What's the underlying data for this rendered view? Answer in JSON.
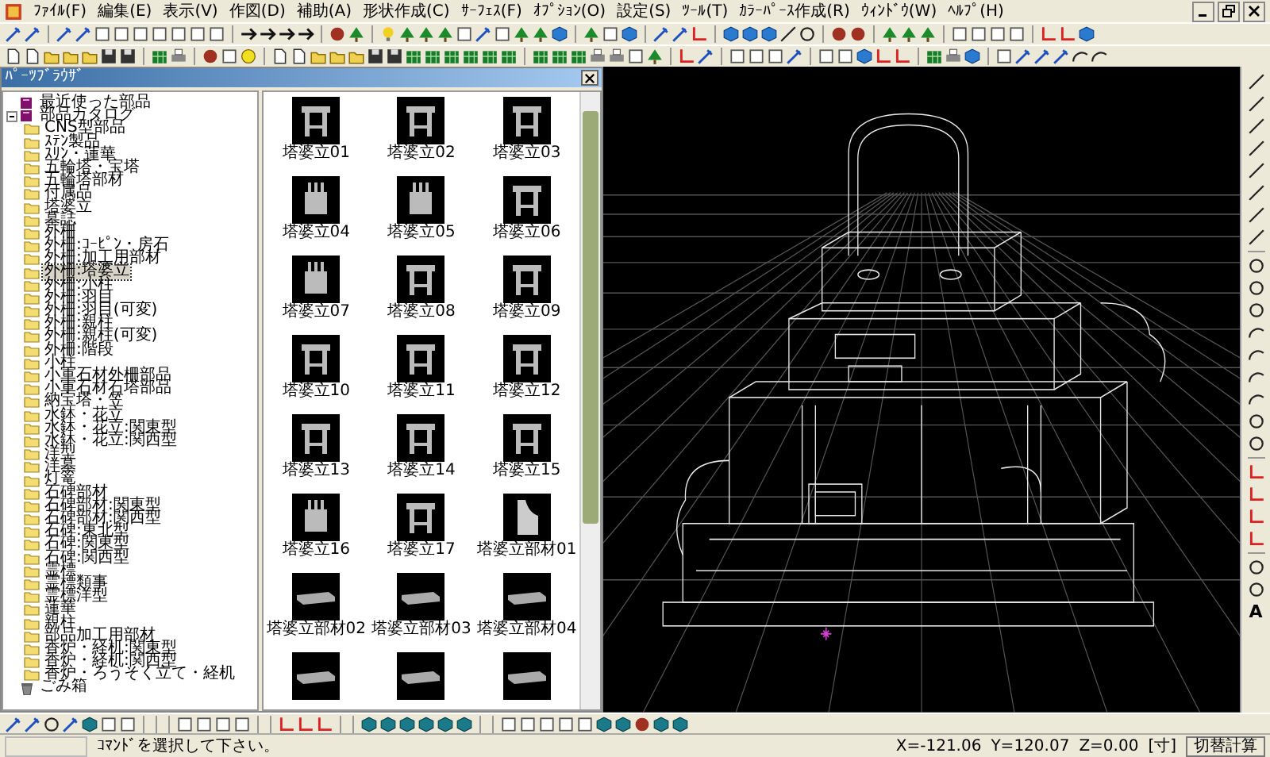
{
  "menu": [
    "ﾌｧｲﾙ(F)",
    "編集(E)",
    "表示(V)",
    "作図(D)",
    "補助(A)",
    "形状作成(C)",
    "ｻｰﾌｪｽ(F)",
    "ｵﾌﾟｼｮﾝ(O)",
    "設定(S)",
    "ﾂｰﾙ(T)",
    "ｶﾗｰﾊﾟｰｽ作成(R)",
    "ｳｨﾝﾄﾞｳ(W)",
    "ﾍﾙﾌﾟ(H)"
  ],
  "parts_browser": {
    "title": "ﾊﾟｰﾂﾌﾞﾗｳｻﾞ",
    "tree": [
      {
        "kind": "recent",
        "label": "最近使った部品",
        "selected": false
      },
      {
        "kind": "catalog",
        "label": "部品カタログ",
        "selected": false,
        "expanded": true,
        "children": [
          {
            "label": "CNS型部品",
            "selected": false
          },
          {
            "label": "ｽﾃﾝ製品",
            "selected": false
          },
          {
            "label": "ｽﾘﾝ・蓮華",
            "selected": false
          },
          {
            "label": "五輪塔・宝塔",
            "selected": false
          },
          {
            "label": "五輪塔部材",
            "selected": false
          },
          {
            "label": "付属品",
            "selected": false
          },
          {
            "label": "塔婆立",
            "selected": false
          },
          {
            "label": "墓誌",
            "selected": false
          },
          {
            "label": "外柵",
            "selected": false
          },
          {
            "label": "外柵:ｺｰﾋﾟﾝ・房石",
            "selected": false
          },
          {
            "label": "外柵:加工用部材",
            "selected": false
          },
          {
            "label": "外柵:塔婆立",
            "selected": true
          },
          {
            "label": "外柵:小柱",
            "selected": false
          },
          {
            "label": "外柵:羽目",
            "selected": false
          },
          {
            "label": "外柵:羽目(可変)",
            "selected": false
          },
          {
            "label": "外柵:親柱",
            "selected": false
          },
          {
            "label": "外柵:親柱(可変)",
            "selected": false
          },
          {
            "label": "外柵:階段",
            "selected": false
          },
          {
            "label": "小柱",
            "selected": false
          },
          {
            "label": "小軍石材外柵部品",
            "selected": false
          },
          {
            "label": "小軍石材石塔部品",
            "selected": false
          },
          {
            "label": "納宝塔・笠",
            "selected": false
          },
          {
            "label": "水鉢・花立",
            "selected": false
          },
          {
            "label": "水鉢・花立:関東型",
            "selected": false
          },
          {
            "label": "水鉢・花立:関西型",
            "selected": false
          },
          {
            "label": "洋型",
            "selected": false
          },
          {
            "label": "洋墓",
            "selected": false
          },
          {
            "label": "灯篭",
            "selected": false
          },
          {
            "label": "石碑部材",
            "selected": false
          },
          {
            "label": "石碑部材:関東型",
            "selected": false
          },
          {
            "label": "石碑部材:関西型",
            "selected": false
          },
          {
            "label": "石碑:東北型",
            "selected": false
          },
          {
            "label": "石碑:関東型",
            "selected": false
          },
          {
            "label": "石碑:関西型",
            "selected": false
          },
          {
            "label": "霊標",
            "selected": false
          },
          {
            "label": "霊標類事",
            "selected": false
          },
          {
            "label": "霊標洋型",
            "selected": false
          },
          {
            "label": "蓮華",
            "selected": false
          },
          {
            "label": "親柱",
            "selected": false
          },
          {
            "label": "部品加工用部材",
            "selected": false
          },
          {
            "label": "香炉・経机:関東型",
            "selected": false
          },
          {
            "label": "香炉・経机:関西型",
            "selected": false
          },
          {
            "label": "香炉・ろうそく立て・経机",
            "selected": false
          }
        ]
      },
      {
        "kind": "trash",
        "label": "ごみ箱",
        "selected": false
      }
    ],
    "thumbnails": [
      {
        "label": "塔婆立01",
        "kind": "frame"
      },
      {
        "label": "塔婆立02",
        "kind": "frame"
      },
      {
        "label": "塔婆立03",
        "kind": "frame"
      },
      {
        "label": "塔婆立04",
        "kind": "post"
      },
      {
        "label": "塔婆立05",
        "kind": "post"
      },
      {
        "label": "塔婆立06",
        "kind": "frame"
      },
      {
        "label": "塔婆立07",
        "kind": "post"
      },
      {
        "label": "塔婆立08",
        "kind": "frame"
      },
      {
        "label": "塔婆立09",
        "kind": "frame"
      },
      {
        "label": "塔婆立10",
        "kind": "frame"
      },
      {
        "label": "塔婆立11",
        "kind": "frame"
      },
      {
        "label": "塔婆立12",
        "kind": "frame"
      },
      {
        "label": "塔婆立13",
        "kind": "frame"
      },
      {
        "label": "塔婆立14",
        "kind": "frame"
      },
      {
        "label": "塔婆立15",
        "kind": "frame"
      },
      {
        "label": "塔婆立16",
        "kind": "post"
      },
      {
        "label": "塔婆立17",
        "kind": "frame"
      },
      {
        "label": "塔婆立部材01",
        "kind": "slab"
      },
      {
        "label": "塔婆立部材02",
        "kind": "bar"
      },
      {
        "label": "塔婆立部材03",
        "kind": "bar"
      },
      {
        "label": "塔婆立部材04",
        "kind": "bar"
      },
      {
        "kind": "bar"
      },
      {
        "kind": "bar"
      },
      {
        "kind": "bar"
      }
    ]
  },
  "right_toolbar": {
    "text_tool": "A"
  },
  "status_bar": {
    "message": "ｺﾏﾝﾄﾞを選択して下さい。",
    "x": "X=-121.06",
    "y": "Y=120.07",
    "z": "Z=0.00",
    "unit": "[寸]",
    "button": "切替計算"
  }
}
